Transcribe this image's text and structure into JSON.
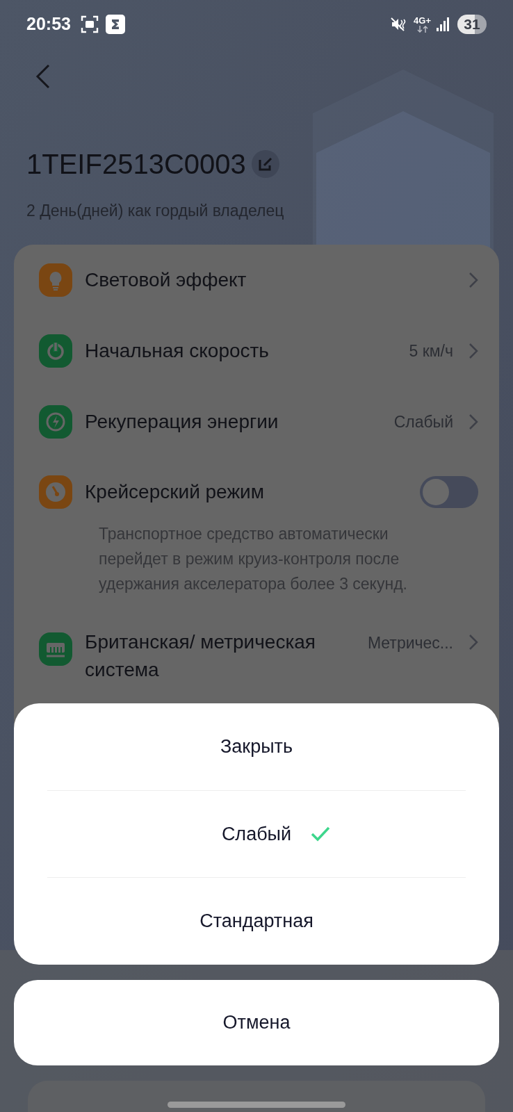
{
  "status_bar": {
    "time": "20:53",
    "network": "4G+",
    "battery": "31"
  },
  "header": {
    "title": "1TEIF2513C0003",
    "subtitle": "2 День(дней) как гордый владелец"
  },
  "settings": [
    {
      "kind": "nav",
      "label": "Световой эффект"
    },
    {
      "kind": "nav",
      "label": "Начальная скорость",
      "value": "5 км/ч"
    },
    {
      "kind": "nav",
      "label": "Рекуперация энергии",
      "value": "Слабый"
    },
    {
      "kind": "toggle",
      "label": "Крейсерский режим",
      "on": false,
      "description": "Транспортное средство автоматически перейдет в режим круиз-контроля после удержания акселератора более 3 секунд."
    },
    {
      "kind": "nav",
      "label": "Британская/ метрическая система",
      "value": "Метричес..."
    }
  ],
  "sheet": {
    "options": [
      {
        "label": "Закрыть",
        "selected": false
      },
      {
        "label": "Слабый",
        "selected": true
      },
      {
        "label": "Стандартная",
        "selected": false
      }
    ],
    "cancel": "Отмена"
  }
}
